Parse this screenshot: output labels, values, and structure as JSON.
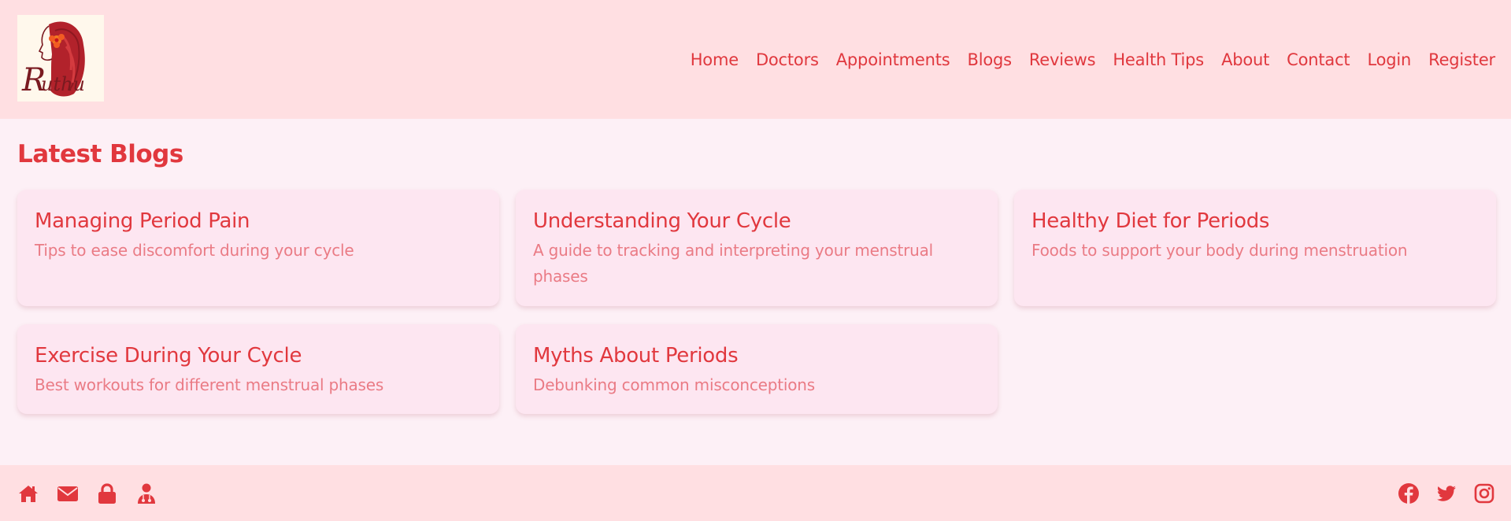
{
  "brand": {
    "logo_text": "Ruthu"
  },
  "nav": {
    "items": [
      {
        "label": "Home"
      },
      {
        "label": "Doctors"
      },
      {
        "label": "Appointments"
      },
      {
        "label": "Blogs"
      },
      {
        "label": "Reviews"
      },
      {
        "label": "Health Tips"
      },
      {
        "label": "About"
      },
      {
        "label": "Contact"
      },
      {
        "label": "Login"
      },
      {
        "label": "Register"
      }
    ]
  },
  "main": {
    "title": "Latest Blogs",
    "blogs": [
      {
        "title": "Managing Period Pain",
        "description": "Tips to ease discomfort during your cycle"
      },
      {
        "title": "Understanding Your Cycle",
        "description": "A guide to tracking and interpreting your menstrual phases"
      },
      {
        "title": "Healthy Diet for Periods",
        "description": "Foods to support your body during menstruation"
      },
      {
        "title": "Exercise During Your Cycle",
        "description": "Best workouts for different menstrual phases"
      },
      {
        "title": "Myths About Periods",
        "description": "Debunking common misconceptions"
      }
    ]
  },
  "footer": {
    "left_icons": [
      "home-icon",
      "envelope-icon",
      "lock-icon",
      "doctor-icon"
    ],
    "right_icons": [
      "facebook-icon",
      "twitter-icon",
      "instagram-icon"
    ]
  },
  "colors": {
    "accent": "#e1383e",
    "header_bg": "#ffdfe2",
    "page_bg": "#fdf0f6",
    "card_bg": "#fde6f1",
    "muted_text": "#ea7b85"
  }
}
